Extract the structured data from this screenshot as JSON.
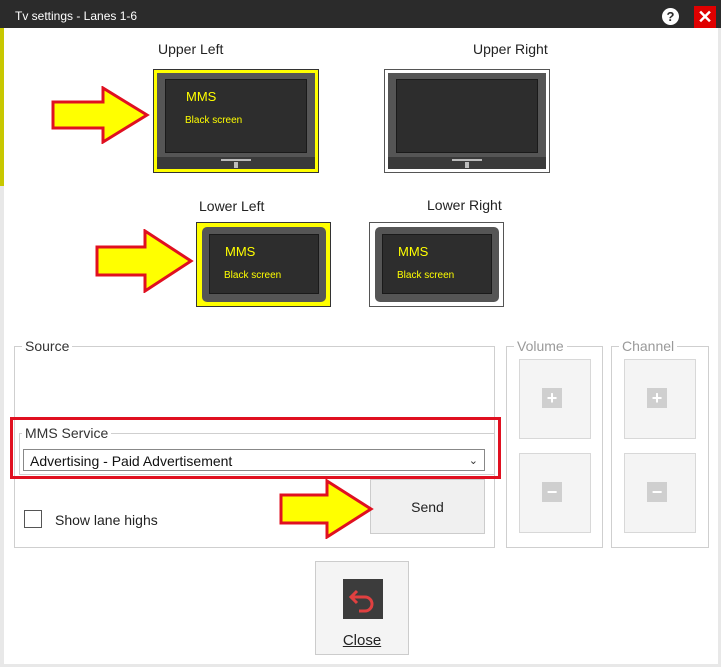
{
  "window": {
    "title": "Tv settings - Lanes 1-6",
    "help_icon": "?",
    "close_icon": "✕"
  },
  "tvs": [
    {
      "id": "upper_left",
      "label": "Upper Left",
      "selected": true,
      "line1": "MMS",
      "line2": "Black screen"
    },
    {
      "id": "upper_right",
      "label": "Upper Right",
      "selected": false,
      "line1": "",
      "line2": ""
    },
    {
      "id": "lower_left",
      "label": "Lower Left",
      "selected": true,
      "line1": "MMS",
      "line2": "Black screen"
    },
    {
      "id": "lower_right",
      "label": "Lower Right",
      "selected": false,
      "line1": "MMS",
      "line2": "Black screen"
    }
  ],
  "source": {
    "title": "Source"
  },
  "mms_service": {
    "title": "MMS Service",
    "selected": "Advertising - Paid Advertisement"
  },
  "show_lane_highs": {
    "label": "Show lane highs",
    "checked": false
  },
  "send_label": "Send",
  "volume": {
    "title": "Volume",
    "plus": "+",
    "minus": "−"
  },
  "channel": {
    "title": "Channel",
    "plus": "+",
    "minus": "−"
  },
  "close_label": "Close",
  "colors": {
    "highlight_yellow": "#ffff00",
    "annotation_red": "#e01020",
    "arrow_yellow": "#ffff00"
  }
}
